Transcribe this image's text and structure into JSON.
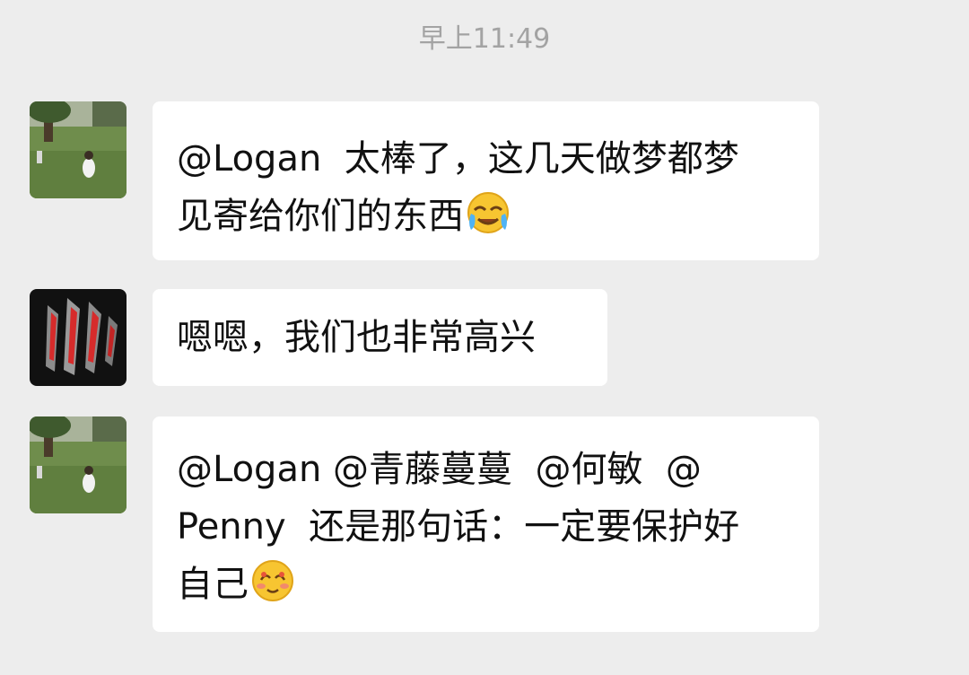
{
  "chat": {
    "timestamp": "早上11:49",
    "messages": [
      {
        "avatar": "park-photo-avatar",
        "line1": "@Logan  太棒了，这几天做梦都梦",
        "line2": "见寄给你们的东西",
        "emoji": "crying-face-emoji"
      },
      {
        "avatar": "claw-marks-avatar",
        "line1": "嗯嗯，我们也非常高兴"
      },
      {
        "avatar": "park-photo-avatar",
        "line1": "@Logan @青藤蔓蔓  @何敏  @",
        "line2": "Penny  还是那句话：一定要保护好",
        "line3": "自己",
        "emoji": "shy-face-emoji"
      }
    ]
  },
  "colors": {
    "background": "#ededed",
    "bubble": "#ffffff",
    "text": "#111111",
    "timestamp": "#a3a3a3"
  }
}
